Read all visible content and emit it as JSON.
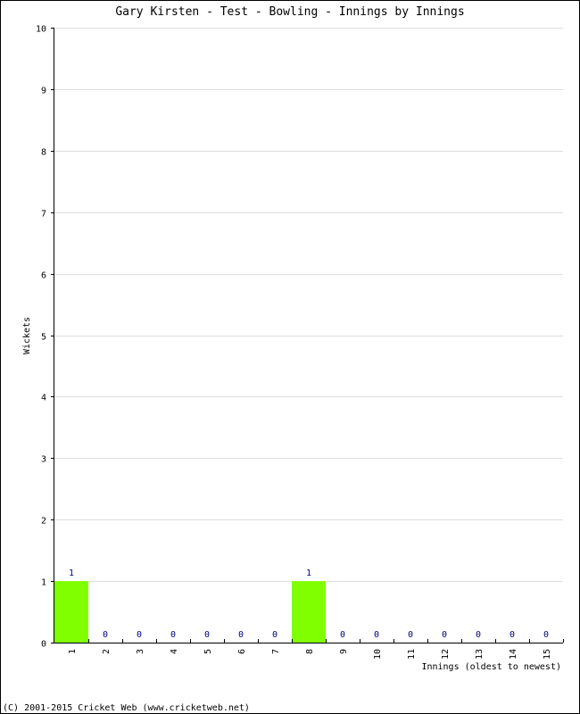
{
  "chart_data": {
    "type": "bar",
    "title": "Gary Kirsten - Test - Bowling - Innings by Innings",
    "xlabel": "Innings (oldest to newest)",
    "ylabel": "Wickets",
    "categories": [
      "1",
      "2",
      "3",
      "4",
      "5",
      "6",
      "7",
      "8",
      "9",
      "10",
      "11",
      "12",
      "13",
      "14",
      "15"
    ],
    "values": [
      1,
      0,
      0,
      0,
      0,
      0,
      0,
      1,
      0,
      0,
      0,
      0,
      0,
      0,
      0
    ],
    "ylim": [
      0,
      10
    ],
    "yticks": [
      0,
      1,
      2,
      3,
      4,
      5,
      6,
      7,
      8,
      9,
      10
    ],
    "grid": true,
    "data_labels": true,
    "legend": "none",
    "colors": {
      "bar": "#80ff00",
      "data_label": "#000080",
      "grid": "#dddddd",
      "axis": "#000000"
    }
  },
  "footer": {
    "copyright": "(C) 2001-2015 Cricket Web (www.cricketweb.net)"
  }
}
